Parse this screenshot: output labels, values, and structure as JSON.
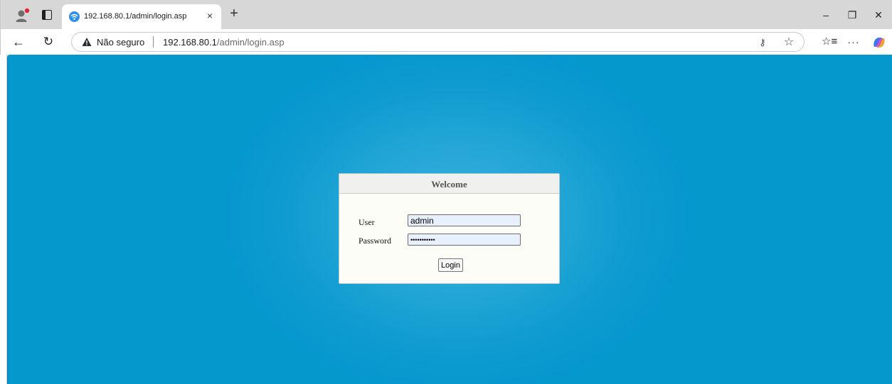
{
  "browser": {
    "tab": {
      "title": "192.168.80.1/admin/login.asp",
      "close_glyph": "×"
    },
    "new_tab_glyph": "+",
    "window_controls": {
      "minimize": "–",
      "restore": "❐",
      "close": "✕"
    },
    "nav": {
      "back": "←",
      "refresh": "↻"
    },
    "address": {
      "security_label": "Não seguro",
      "url_host": "192.168.80.1",
      "url_path": "/admin/login.asp"
    },
    "icons": [
      "profile-icon",
      "tab-actions-icon",
      "wifi-favicon-icon",
      "warning-icon",
      "key-icon",
      "star-icon",
      "favorites-icon",
      "more-icon",
      "copilot-icon"
    ],
    "colors": {
      "tabbar": "#d7d7d7",
      "page_background": "#0e9bd0",
      "page_center": "#37b2dc",
      "profile_badge": "#e0263b"
    }
  },
  "login": {
    "title": "Welcome",
    "user_label": "User",
    "user_value": "admin",
    "password_label": "Password",
    "password_value": "•••••••••••",
    "submit_label": "Login"
  }
}
